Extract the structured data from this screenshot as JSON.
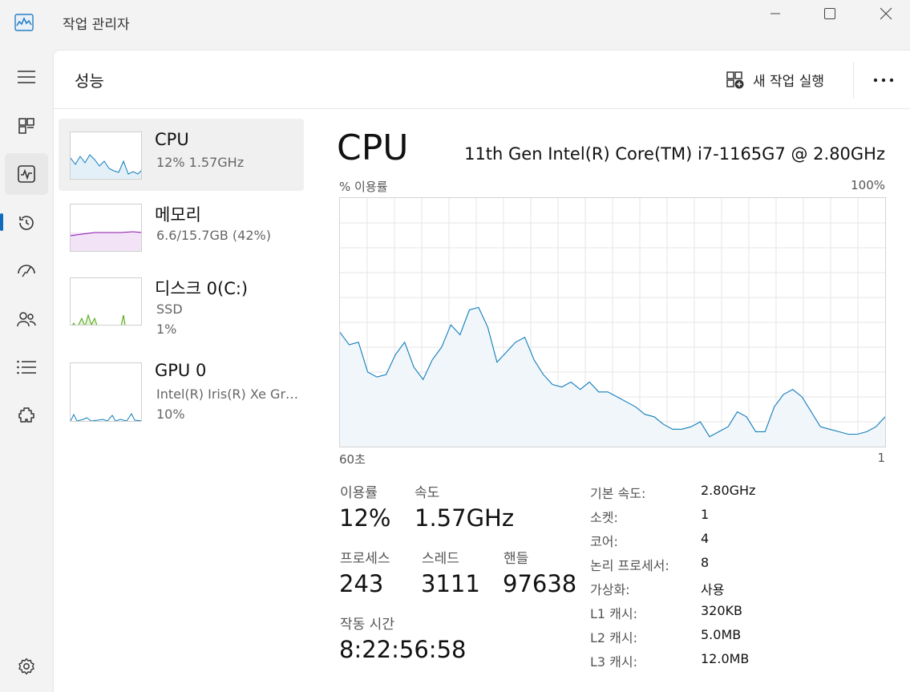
{
  "window": {
    "title": "작업 관리자"
  },
  "header": {
    "title": "성능",
    "run_task_label": "새 작업 실행"
  },
  "list": [
    {
      "name": "CPU",
      "line1": "12%  1.57GHz",
      "line2": ""
    },
    {
      "name": "메모리",
      "line1": "6.6/15.7GB (42%)",
      "line2": ""
    },
    {
      "name": "디스크 0(C:)",
      "line1": "SSD",
      "line2": "1%"
    },
    {
      "name": "GPU 0",
      "line1": "Intel(R) Iris(R) Xe Gra...",
      "line2": "10%"
    }
  ],
  "detail": {
    "title": "CPU",
    "model": "11th Gen Intel(R) Core(TM) i7-1165G7 @ 2.80GHz",
    "y_label": "% 이용률",
    "y_max_label": "100%",
    "x_left_label": "60초",
    "x_right_label": "1"
  },
  "stats": {
    "utilization_label": "이용률",
    "utilization_value": "12%",
    "speed_label": "속도",
    "speed_value": "1.57GHz",
    "processes_label": "프로세스",
    "processes_value": "243",
    "threads_label": "스레드",
    "threads_value": "3111",
    "handles_label": "핸들",
    "handles_value": "97638",
    "uptime_label": "작동 시간",
    "uptime_value": "8:22:56:58"
  },
  "specs": [
    {
      "label": "기본 속도:",
      "value": "2.80GHz"
    },
    {
      "label": "소켓:",
      "value": "1"
    },
    {
      "label": "코어:",
      "value": "4"
    },
    {
      "label": "논리 프로세서:",
      "value": "8"
    },
    {
      "label": "가상화:",
      "value": "사용"
    },
    {
      "label": "L1 캐시:",
      "value": "320KB"
    },
    {
      "label": "L2 캐시:",
      "value": "5.0MB"
    },
    {
      "label": "L3 캐시:",
      "value": "12.0MB"
    }
  ],
  "colors": {
    "cpu": "#117dbb",
    "memory": "#8b12ae",
    "disk": "#4da60c",
    "accent": "#0f6cbd"
  },
  "icons": [
    "task-manager-icon",
    "hamburger-icon",
    "processes-icon",
    "performance-icon",
    "app-history-icon",
    "startup-icon",
    "users-icon",
    "details-icon",
    "services-icon",
    "settings-icon",
    "run-task-icon",
    "more-icon"
  ],
  "chart_data": {
    "type": "area",
    "ylabel": "% 이용률",
    "ylim": [
      0,
      100
    ],
    "xlim": [
      60,
      1
    ],
    "grid": true,
    "x": [
      60,
      59,
      58,
      57,
      56,
      55,
      54,
      53,
      52,
      51,
      50,
      49,
      48,
      47,
      46,
      45,
      44,
      43,
      42,
      41,
      40,
      39,
      38,
      37,
      36,
      35,
      34,
      33,
      32,
      31,
      30,
      29,
      28,
      27,
      26,
      25,
      24,
      23,
      22,
      21,
      20,
      19,
      18,
      17,
      16,
      15,
      14,
      13,
      12,
      11,
      10,
      9,
      8,
      7,
      6,
      5,
      4,
      3,
      2,
      1
    ],
    "values": [
      46,
      41,
      42,
      30,
      28,
      29,
      37,
      42,
      32,
      27,
      35,
      40,
      49,
      45,
      55,
      56,
      48,
      34,
      38,
      42,
      44,
      35,
      29,
      25,
      24,
      26,
      23,
      26,
      22,
      22,
      20,
      18,
      16,
      13,
      12,
      9,
      7,
      7,
      8,
      10,
      4,
      6,
      8,
      14,
      12,
      6,
      6,
      16,
      21,
      23,
      20,
      14,
      8,
      7,
      6,
      5,
      5,
      6,
      8,
      12
    ]
  }
}
